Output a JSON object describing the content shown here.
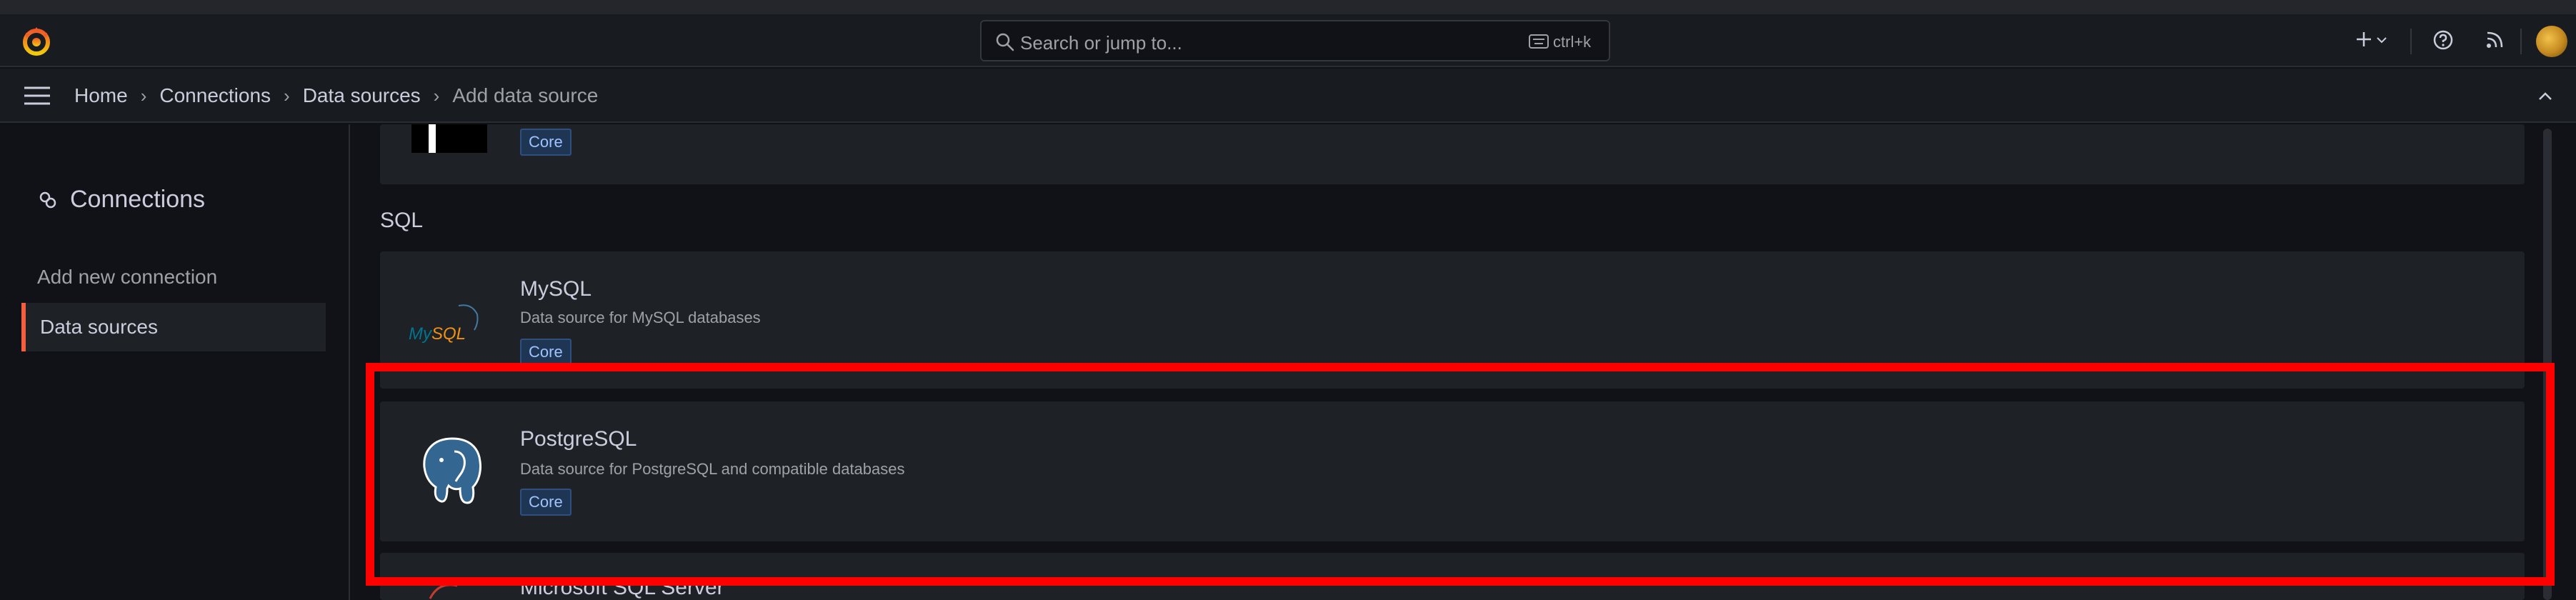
{
  "search": {
    "placeholder": "Search or jump to...",
    "shortcut": "ctrl+k"
  },
  "breadcrumb": [
    {
      "label": "Home"
    },
    {
      "label": "Connections"
    },
    {
      "label": "Data sources"
    },
    {
      "label": "Add data source"
    }
  ],
  "sidebar": {
    "title": "Connections",
    "items": [
      {
        "label": "Add new connection",
        "active": false
      },
      {
        "label": "Data sources",
        "active": true
      }
    ]
  },
  "main": {
    "previous_card": {
      "badge": "Core"
    },
    "section_label": "SQL",
    "cards": [
      {
        "name": "MySQL",
        "description": "Data source for MySQL databases",
        "badge": "Core",
        "logo_text": "MySQL"
      },
      {
        "name": "PostgreSQL",
        "description": "Data source for PostgreSQL and compatible databases",
        "badge": "Core"
      },
      {
        "name": "Microsoft SQL Server"
      }
    ]
  },
  "colors": {
    "accent": "#f55f3e",
    "highlight": "#ff0000",
    "badge_bg": "#1f3554",
    "badge_text": "#9ec3ff"
  },
  "icons": {
    "logo": "grafana-logo-icon",
    "search": "search-icon",
    "keyboard": "keyboard-icon",
    "add": "plus-icon",
    "help": "help-icon",
    "news": "rss-icon",
    "menu": "hamburger-icon",
    "collapse": "chevron-up-icon",
    "connections": "connections-icon"
  }
}
